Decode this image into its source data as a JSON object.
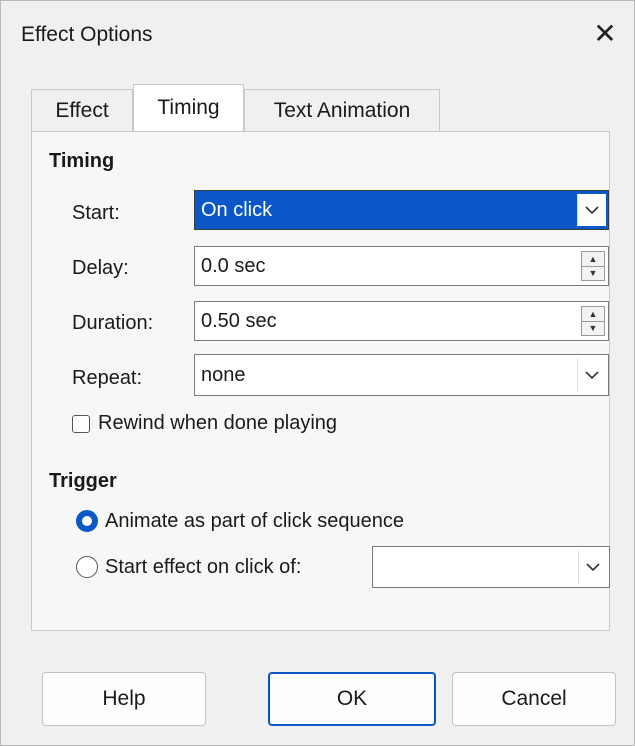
{
  "window": {
    "title": "Effect Options",
    "close_glyph": "✕"
  },
  "tabs": [
    {
      "label": "Effect",
      "active": false
    },
    {
      "label": "Timing",
      "active": true
    },
    {
      "label": "Text Animation",
      "active": false
    }
  ],
  "timing": {
    "section_title": "Timing",
    "start": {
      "label": "Start:",
      "value": "On click"
    },
    "delay": {
      "label": "Delay:",
      "value": "0.0 sec"
    },
    "duration": {
      "label": "Duration:",
      "value": "0.50 sec"
    },
    "repeat": {
      "label": "Repeat:",
      "value": "none"
    },
    "rewind": {
      "label": "Rewind when done playing",
      "checked": false
    }
  },
  "trigger": {
    "section_title": "Trigger",
    "options": [
      {
        "label": "Animate as part of click sequence",
        "checked": true
      },
      {
        "label": "Start effect on click of:",
        "checked": false
      }
    ],
    "target_value": ""
  },
  "buttons": {
    "help": "Help",
    "ok": "OK",
    "cancel": "Cancel"
  },
  "icons": {
    "dropdown": "chevron-down-icon",
    "spin_up": "▲",
    "spin_down": "▼"
  },
  "colors": {
    "accent": "#0a58c8",
    "dialog_bg": "#f0f0f0"
  }
}
